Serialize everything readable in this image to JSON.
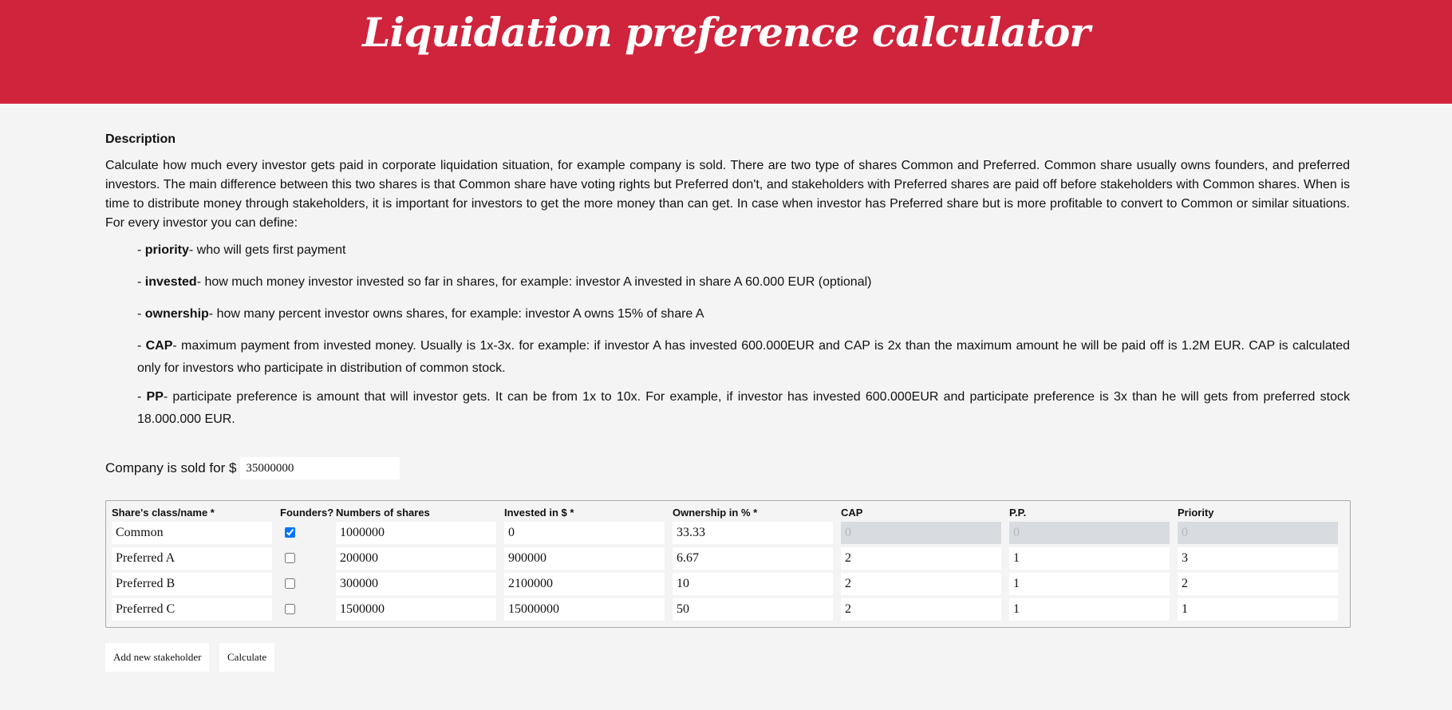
{
  "header": {
    "title": "Liquidation preference calculator"
  },
  "description": {
    "title": "Description",
    "text": "Calculate how much every investor gets paid in corporate liquidation situation, for example company is sold. There are two type of shares Common and Preferred. Common share usually owns founders, and preferred investors. The main difference between this two shares is that Common share have voting rights but Preferred don't, and stakeholders with Preferred shares are paid off before stakeholders with Common shares. When is time to distribute money through stakeholders, it is important for investors to get the more money than can get. In case when investor has Preferred share but is more profitable to convert to Common or similar situations. For every investor you can define:",
    "bullets": [
      {
        "term": "priority",
        "text": "- who will gets first payment"
      },
      {
        "term": "invested",
        "text": "- how much money investor invested so far in shares, for example: investor A invested in share A 60.000 EUR (optional)"
      },
      {
        "term": "ownership",
        "text": "- how many percent investor owns shares, for example: investor A owns 15% of share A"
      },
      {
        "term": "CAP",
        "text": "- maximum payment from invested money. Usually is 1x-3x. for example: if investor A has invested 600.000EUR and CAP is 2x than the maximum amount he will be paid off is 1.2M EUR. CAP is calculated only for investors who participate in distribution of common stock."
      },
      {
        "term": "PP",
        "text": "- participate preference is amount that will investor gets. It can be from 1x to 10x. For example, if investor has invested 600.000EUR and participate preference is 3x than he will gets from preferred stock 18.000.000 EUR."
      }
    ]
  },
  "sale": {
    "label": "Company is sold for $",
    "value": "35000000"
  },
  "table": {
    "headers": {
      "name": "Share's class/name *",
      "founders": "Founders?",
      "shares": "Numbers of shares",
      "invested": "Invested in $ *",
      "ownership": "Ownership in % *",
      "cap": "CAP",
      "pp": "P.P.",
      "priority": "Priority"
    },
    "rows": [
      {
        "name": "Common",
        "founders": true,
        "shares": "1000000",
        "invested": "0",
        "ownership": "33.33",
        "cap": "0",
        "pp": "0",
        "priority": "0",
        "disabled": true
      },
      {
        "name": "Preferred A",
        "founders": false,
        "shares": "200000",
        "invested": "900000",
        "ownership": "6.67",
        "cap": "2",
        "pp": "1",
        "priority": "3",
        "disabled": false
      },
      {
        "name": "Preferred B",
        "founders": false,
        "shares": "300000",
        "invested": "2100000",
        "ownership": "10",
        "cap": "2",
        "pp": "1",
        "priority": "2",
        "disabled": false
      },
      {
        "name": "Preferred C",
        "founders": false,
        "shares": "1500000",
        "invested": "15000000",
        "ownership": "50",
        "cap": "2",
        "pp": "1",
        "priority": "1",
        "disabled": false
      }
    ]
  },
  "buttons": {
    "add": "Add new stakeholder",
    "calculate": "Calculate"
  }
}
